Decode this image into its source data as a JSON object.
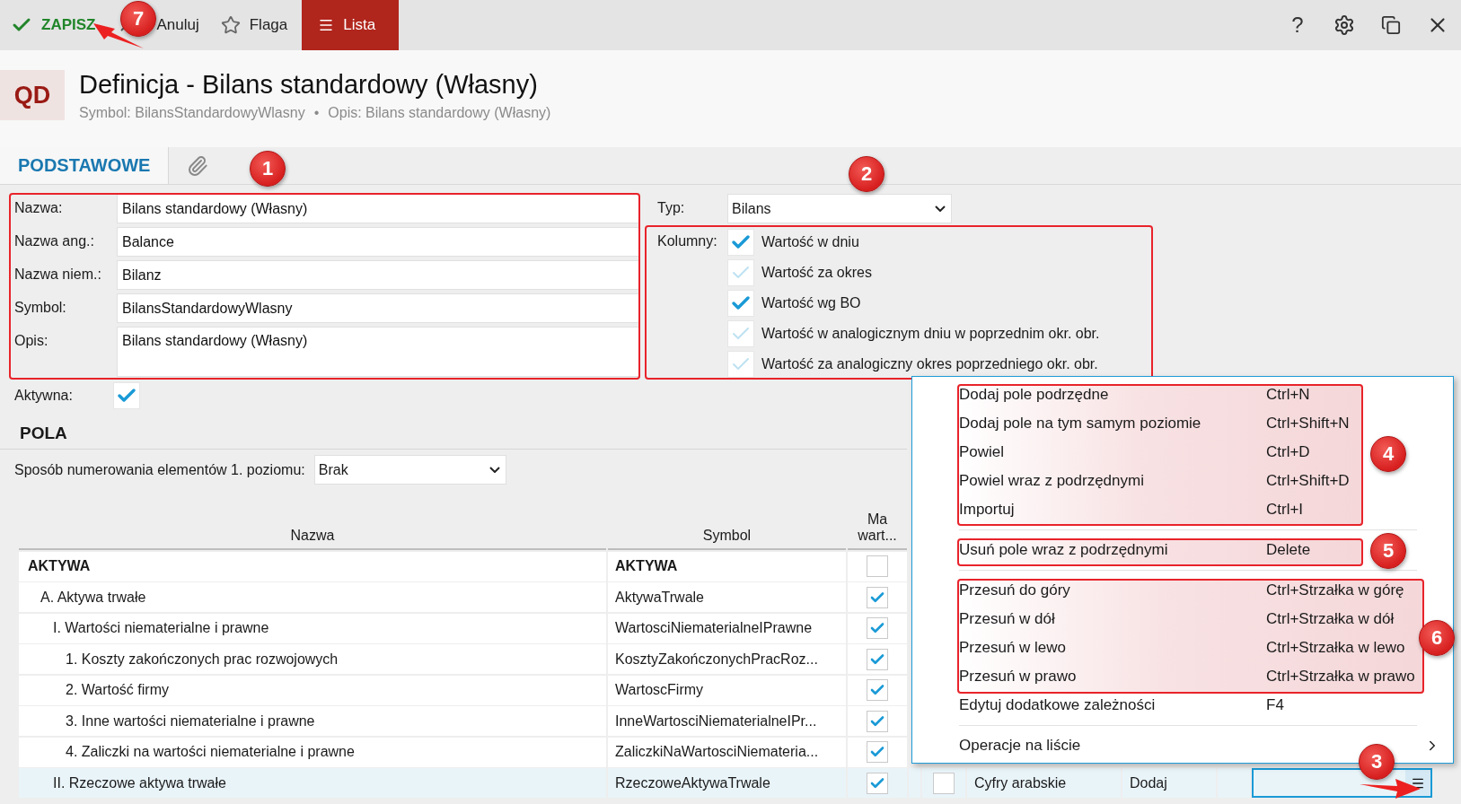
{
  "toolbar": {
    "save": "ZAPISZ",
    "cancel": "Anuluj",
    "flag": "Flaga",
    "list": "Lista",
    "help": "?"
  },
  "header": {
    "badge": "QD",
    "title": "Definicja - Bilans standardowy (Własny)",
    "symbol": "Symbol: BilansStandardowyWlasny",
    "separator": "•",
    "description": "Opis: Bilans standardowy (Własny)"
  },
  "tabs": [
    {
      "kind": "text",
      "label": "PODSTAWOWE",
      "selected": true
    },
    {
      "kind": "attachment",
      "selected": false
    }
  ],
  "form": {
    "fields": [
      {
        "kind": "line",
        "label": "Nazwa:",
        "value": "Bilans standardowy (Własny)"
      },
      {
        "kind": "line",
        "label": "Nazwa ang.:",
        "value": "Balance"
      },
      {
        "kind": "line",
        "label": "Nazwa niem.:",
        "value": "Bilanz"
      },
      {
        "kind": "line",
        "label": "Symbol:",
        "value": "BilansStandardowyWlasny"
      },
      {
        "kind": "multiline",
        "label": "Opis:",
        "value": "Bilans standardowy (Własny)"
      }
    ],
    "active": {
      "label": "Aktywna:",
      "checked": true
    },
    "type": {
      "label": "Typ:",
      "value": "Bilans"
    },
    "columns": {
      "label": "Kolumny:",
      "options": [
        {
          "label": "Wartość w dniu",
          "checked": true
        },
        {
          "label": "Wartość za okres",
          "checked": false
        },
        {
          "label": "Wartość wg BO",
          "checked": true
        },
        {
          "label": "Wartość w analogicznym dniu w poprzednim okr. obr.",
          "checked": false
        },
        {
          "label": "Wartość za analogiczny okres poprzedniego okr. obr.",
          "checked": false
        }
      ]
    }
  },
  "fields_section": {
    "title": "POLA",
    "numbering": {
      "label": "Sposób numerowania elementów 1. poziomu:",
      "value": "Brak"
    },
    "table": {
      "columns": [
        "Nazwa",
        "Symbol",
        "Ma wart..."
      ],
      "rows": [
        {
          "name": "AKTYWA",
          "symbol": "AKTYWA",
          "has_value": false,
          "selected": false,
          "children": [
            {
              "name": "A. Aktywa trwałe",
              "symbol": "AktywaTrwale",
              "has_value": true,
              "selected": false,
              "children": [
                {
                  "name": "I. Wartości niematerialne i prawne",
                  "symbol": "WartosciNiematerialneIPrawne",
                  "has_value": true,
                  "selected": false,
                  "children": [
                    {
                      "name": "1. Koszty zakończonych prac rozwojowych",
                      "symbol": "KosztyZakończonychPracRoz...",
                      "has_value": true,
                      "selected": false
                    },
                    {
                      "name": "2. Wartość firmy",
                      "symbol": "WartoscFirmy",
                      "has_value": true,
                      "selected": false
                    },
                    {
                      "name": "3. Inne wartości niematerialne i prawne",
                      "symbol": "InneWartosciNiematerialneIPr...",
                      "has_value": true,
                      "selected": false
                    },
                    {
                      "name": "4. Zaliczki na wartości niematerialne i prawne",
                      "symbol": "ZaliczkiNaWartosciNiemateria...",
                      "has_value": true,
                      "selected": false
                    }
                  ]
                },
                {
                  "name": "II. Rzeczowe aktywa trwałe",
                  "symbol": "RzeczoweAktywaTrwale",
                  "has_value": true,
                  "selected": true,
                  "column_5": {
                    "checked": false
                  },
                  "column_6": "Cyfry arabskie",
                  "column_7": "Dodaj",
                  "column_9": {
                    "kind": "menu-field"
                  }
                }
              ]
            }
          ]
        }
      ]
    }
  },
  "context_menu": {
    "sections": [
      [
        {
          "label": "Dodaj pole podrzędne",
          "shortcut": "Ctrl+N",
          "submenu": false
        },
        {
          "label": "Dodaj pole na tym samym poziomie",
          "shortcut": "Ctrl+Shift+N",
          "submenu": false
        },
        {
          "label": "Powiel",
          "shortcut": "Ctrl+D",
          "submenu": false
        },
        {
          "label": "Powiel wraz z podrzędnymi",
          "shortcut": "Ctrl+Shift+D",
          "submenu": false
        },
        {
          "label": "Importuj",
          "shortcut": "Ctrl+I",
          "submenu": false
        }
      ],
      [
        {
          "label": "Usuń pole wraz z podrzędnymi",
          "shortcut": "Delete",
          "submenu": false
        }
      ],
      [
        {
          "label": "Przesuń do góry",
          "shortcut": "Ctrl+Strzałka w górę",
          "submenu": false
        },
        {
          "label": "Przesuń w dół",
          "shortcut": "Ctrl+Strzałka w dół",
          "submenu": false
        },
        {
          "label": "Przesuń w lewo",
          "shortcut": "Ctrl+Strzałka w lewo",
          "submenu": false
        },
        {
          "label": "Przesuń w prawo",
          "shortcut": "Ctrl+Strzałka w prawo",
          "submenu": false
        },
        {
          "label": "Edytuj dodatkowe zależności",
          "shortcut": "F4",
          "submenu": false
        }
      ],
      [
        {
          "label": "Operacje na liście",
          "submenu": true
        }
      ]
    ]
  },
  "callouts": [
    "1",
    "2",
    "3",
    "4",
    "5",
    "6",
    "7"
  ]
}
